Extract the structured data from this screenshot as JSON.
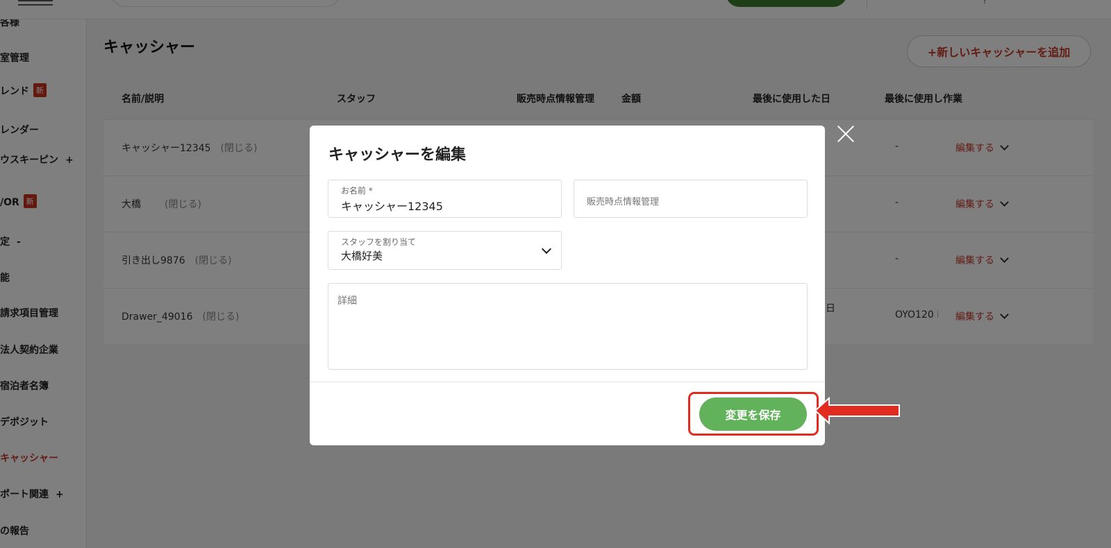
{
  "topbar": {
    "mark": "?"
  },
  "sidebar": {
    "items": [
      {
        "label": "各様"
      },
      {
        "label": "室管理"
      },
      {
        "label": "レンド",
        "badge": "新"
      },
      {
        "label": "レンダー"
      },
      {
        "label": "ウスキーピン",
        "plus": "+"
      },
      {
        "label": "/OR",
        "badge": "新"
      },
      {
        "label": "定",
        "plus": "-"
      },
      {
        "label": "能"
      },
      {
        "label": "請求項目管理"
      },
      {
        "label": "法人契約企業"
      },
      {
        "label": "宿泊者名簿"
      },
      {
        "label": "デポジット"
      },
      {
        "label": "キャッシャー"
      },
      {
        "label": "ポート関連",
        "plus": "+"
      },
      {
        "label": "の報告"
      }
    ]
  },
  "main": {
    "title": "キャッシャー",
    "add_button": "+新しいキャッシャーを追加",
    "columns": [
      "名前/説明",
      "スタッフ",
      "販売時点情報管理",
      "金額",
      "最後に使用した日",
      "最後に使用し作業"
    ],
    "rows": [
      {
        "name": "キャッシャー12345",
        "status": "(閉じる)",
        "last_date": "",
        "last_action": "-",
        "edit": "編集する"
      },
      {
        "name": "大橋",
        "status": "(閉じる)",
        "last_date": "",
        "last_action": "-",
        "edit": "編集する"
      },
      {
        "name": "引き出し9876",
        "status": "(閉じる)",
        "last_date": "",
        "last_action": "-",
        "edit": "編集する"
      },
      {
        "name": "Drawer_49016",
        "status": "(閉じる)",
        "last_date": "日",
        "last_action": "OYO120 D",
        "edit": "編集する"
      }
    ]
  },
  "modal": {
    "title": "キャッシャーを編集",
    "name_label": "お名前 *",
    "name_value": "キャッシャー12345",
    "pos_placeholder": "販売時点情報管理",
    "staff_label": "スタッフを割り当て",
    "staff_value": "大橋好美",
    "details_placeholder": "詳細",
    "save_button": "変更を保存"
  },
  "colors": {
    "accent": "#c63b2a",
    "save": "#62b25b",
    "highlight": "#e12b1f"
  }
}
